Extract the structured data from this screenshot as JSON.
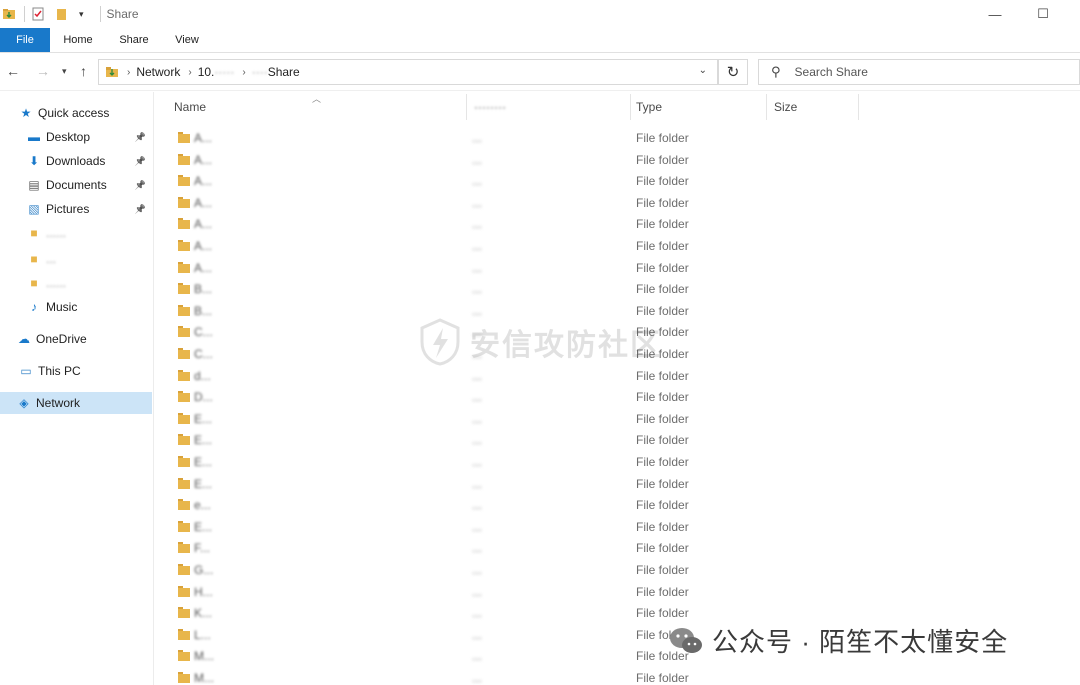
{
  "window": {
    "title": "Share",
    "minimize_glyph": "—",
    "maximize_glyph": "☐"
  },
  "ribbon": {
    "tabs": [
      {
        "label": "File"
      },
      {
        "label": "Home"
      },
      {
        "label": "Share"
      },
      {
        "label": "View"
      }
    ]
  },
  "address": {
    "crumbs": [
      "Network",
      "10.",
      "Share"
    ],
    "refresh_glyph": "↻",
    "search_placeholder": "Search Share"
  },
  "nav_glyphs": {
    "back": "←",
    "forward": "→",
    "recent": "▾",
    "up": "↑",
    "chevron": "⌄",
    "crumb_sep": "›",
    "search": "⚲",
    "pin": "📌"
  },
  "sidebar": {
    "items": [
      {
        "label": "Quick access",
        "icon": "star-icon",
        "glyph": "★",
        "color": "#1979ca"
      },
      {
        "label": "Desktop",
        "icon": "desktop-icon",
        "glyph": "▬",
        "color": "#1979ca",
        "pinned": true
      },
      {
        "label": "Downloads",
        "icon": "download-icon",
        "glyph": "⬇",
        "color": "#1979ca",
        "pinned": true
      },
      {
        "label": "Documents",
        "icon": "document-icon",
        "glyph": "▤",
        "color": "#5a5a5a",
        "pinned": true
      },
      {
        "label": "Pictures",
        "icon": "picture-icon",
        "glyph": "▧",
        "color": "#3a87c9",
        "pinned": true
      },
      {
        "label": "",
        "icon": "folder-icon",
        "glyph": "■",
        "color": "#e8b64b",
        "blurred": "......"
      },
      {
        "label": "",
        "icon": "folder-icon",
        "glyph": "■",
        "color": "#e8b64b",
        "blurred": "..."
      },
      {
        "label": "",
        "icon": "folder-icon",
        "glyph": "■",
        "color": "#e8b64b",
        "blurred": "......"
      },
      {
        "label": "Music",
        "icon": "music-icon",
        "glyph": "♪",
        "color": "#1979ca"
      },
      {
        "label": "OneDrive",
        "icon": "cloud-icon",
        "glyph": "☁",
        "color": "#1979ca"
      },
      {
        "label": "This PC",
        "icon": "computer-icon",
        "glyph": "▭",
        "color": "#3a87c9"
      },
      {
        "label": "Network",
        "icon": "network-icon",
        "glyph": "◈",
        "color": "#1979ca",
        "selected": true
      }
    ]
  },
  "columns": {
    "name": "Name",
    "date": "",
    "type": "Type",
    "size": "Size"
  },
  "files": {
    "type_label": "File folder",
    "rows": [
      {
        "name": "A...",
        "date": "..."
      },
      {
        "name": "A...",
        "date": "..."
      },
      {
        "name": "A...",
        "date": "..."
      },
      {
        "name": "A...",
        "date": "..."
      },
      {
        "name": "A...",
        "date": "..."
      },
      {
        "name": "A...",
        "date": "..."
      },
      {
        "name": "A...",
        "date": "..."
      },
      {
        "name": "B...",
        "date": "..."
      },
      {
        "name": "B...",
        "date": "..."
      },
      {
        "name": "C...",
        "date": "..."
      },
      {
        "name": "C...",
        "date": "..."
      },
      {
        "name": "d...",
        "date": "..."
      },
      {
        "name": "D...",
        "date": "..."
      },
      {
        "name": "E...",
        "date": "..."
      },
      {
        "name": "E...",
        "date": "..."
      },
      {
        "name": "E...",
        "date": "..."
      },
      {
        "name": "E...",
        "date": "..."
      },
      {
        "name": "e...",
        "date": "..."
      },
      {
        "name": "E...",
        "date": "..."
      },
      {
        "name": "F...",
        "date": "..."
      },
      {
        "name": "G...",
        "date": "..."
      },
      {
        "name": "H...",
        "date": "..."
      },
      {
        "name": "K...",
        "date": "..."
      },
      {
        "name": "L...",
        "date": "..."
      },
      {
        "name": "M...",
        "date": "..."
      },
      {
        "name": "M...",
        "date": "..."
      }
    ]
  },
  "watermarks": {
    "center": "安信攻防社区",
    "bottom": "公众号 · 陌笙不太懂安全"
  },
  "colors": {
    "accent": "#1979ca",
    "folder": "#e8b64b",
    "selection": "#cce4f7"
  }
}
